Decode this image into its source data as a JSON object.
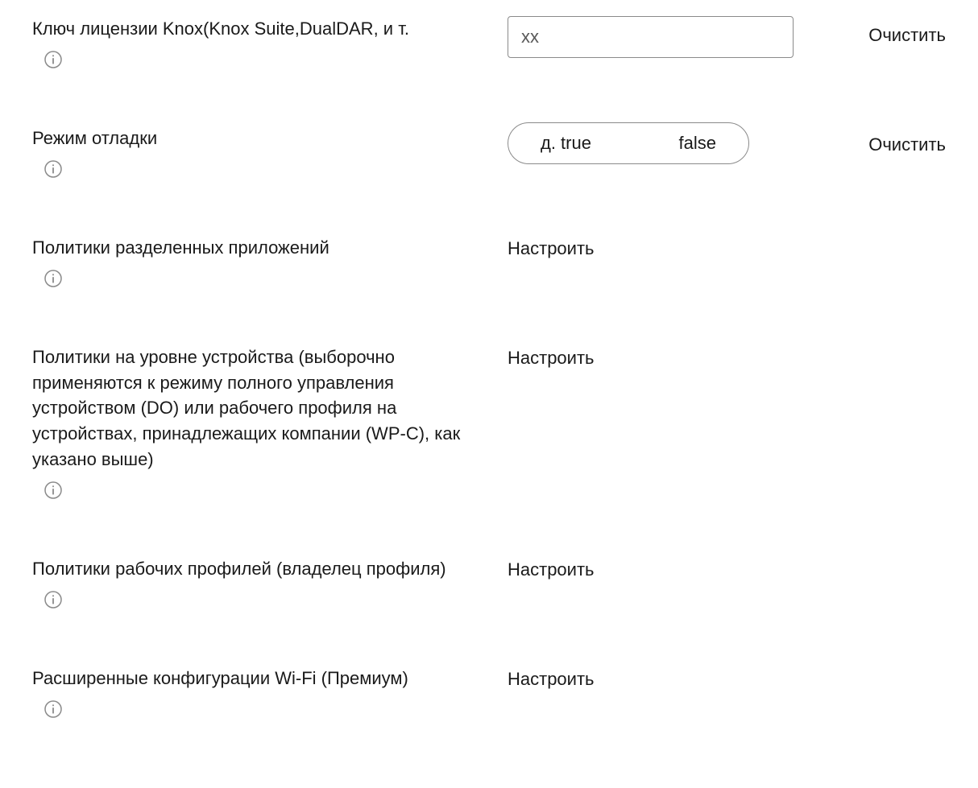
{
  "common": {
    "clear": "Очистить",
    "configure": "Настроить"
  },
  "rows": {
    "license": {
      "label": "Ключ лицензии Knox(Knox Suite,DualDAR, и т.",
      "placeholder": "xx"
    },
    "debug": {
      "label": "Режим отладки",
      "optTrue": "д. true",
      "optFalse": "false"
    },
    "split": {
      "label": "Политики разделенных приложений"
    },
    "device": {
      "label": "Политики на уровне устройства (выборочно применяются к режиму полного управления устройством (DO) или рабочего профиля на устройствах, принадлежащих компании (WP-C), как указано выше)"
    },
    "work": {
      "label": "Политики рабочих профилей (владелец профиля)"
    },
    "wifi": {
      "label": "Расширенные конфигурации Wi-Fi (Премиум)"
    }
  },
  "icons": {
    "info": "info"
  }
}
